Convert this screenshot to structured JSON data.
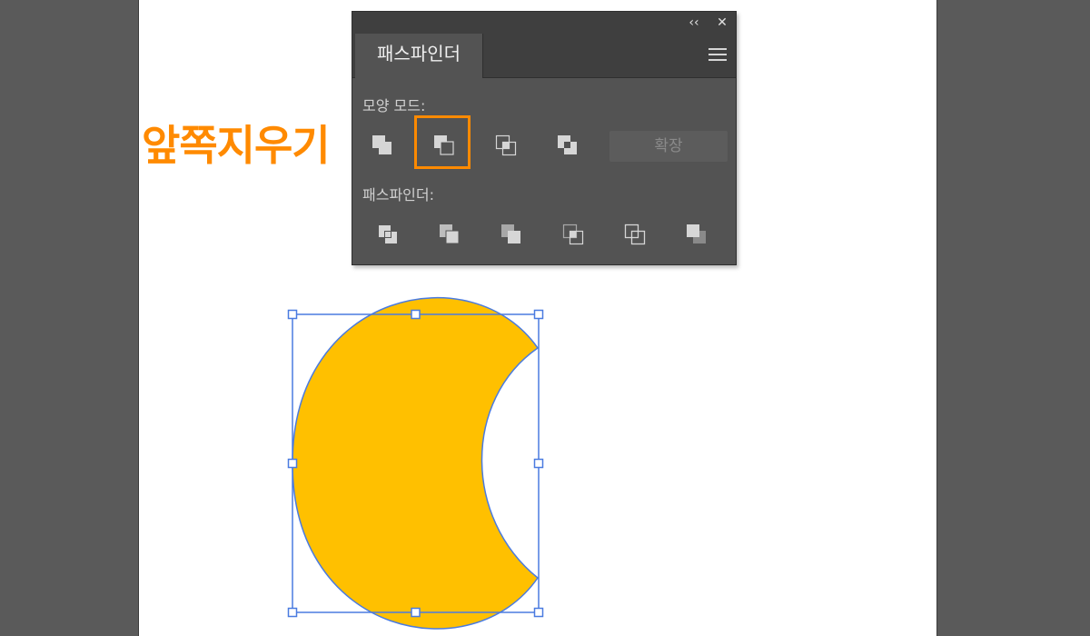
{
  "caption": "앞쪽지우기",
  "panel": {
    "tab_title": "패스파인더",
    "collapse_glyph": "‹‹",
    "close_glyph": "✕",
    "shape_modes_label": "모양 모드:",
    "pathfinders_label": "패스파인더:",
    "expand_label": "확장",
    "shape_mode_icons": [
      "unite-icon",
      "minus-front-icon",
      "intersect-icon",
      "exclude-icon"
    ],
    "pathfinder_icons": [
      "divide-icon",
      "trim-icon",
      "merge-icon",
      "crop-icon",
      "outline-icon",
      "minus-back-icon"
    ],
    "selected_shape_mode": "minus-front-icon"
  },
  "colors": {
    "highlight": "#ff8a00",
    "shape_fill": "#ffc000",
    "selection": "#4a7be0"
  }
}
